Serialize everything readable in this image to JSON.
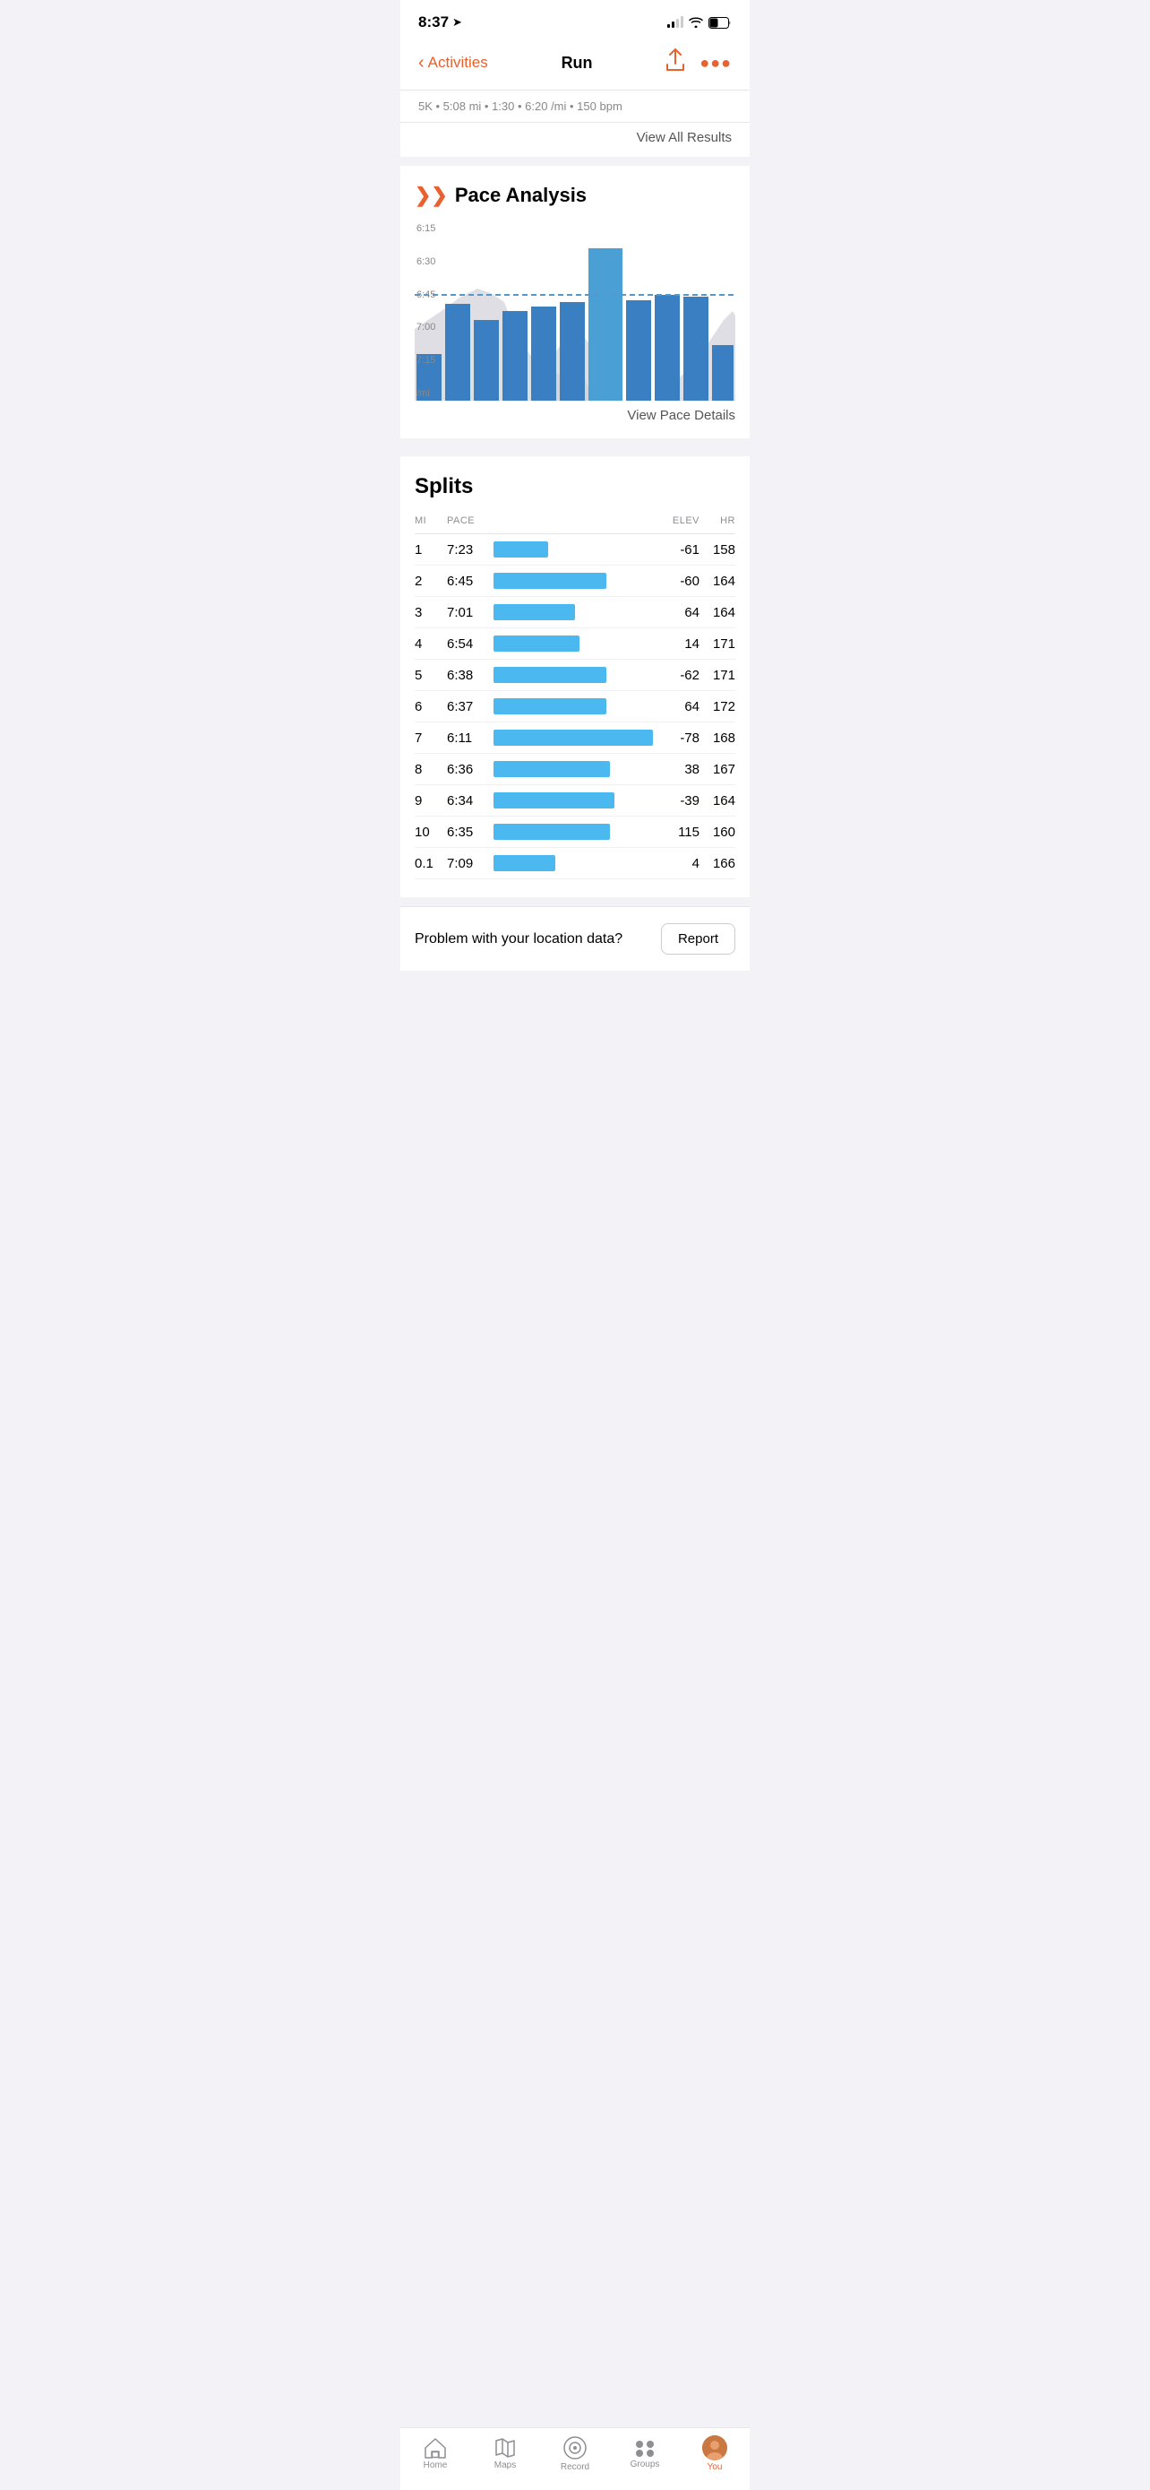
{
  "statusBar": {
    "time": "8:37",
    "locationIcon": "➤"
  },
  "navBar": {
    "backLabel": "Activities",
    "title": "Run",
    "shareLabel": "share",
    "moreLabel": "•••"
  },
  "topCutoff": {
    "text": "5K  •  5:08 mi  •  1:30  •  6:20 /mi  •  150 bpm"
  },
  "viewAllResults": "View All Results",
  "paceAnalysis": {
    "title": "Pace Analysis",
    "yLabels": [
      "6:15",
      "6:30",
      "6:45",
      "7:00",
      "7:15",
      "/mi"
    ],
    "viewPaceDetails": "View Pace Details"
  },
  "splits": {
    "title": "Splits",
    "headers": {
      "mi": "MI",
      "pace": "PACE",
      "elev": "ELEV",
      "hr": "HR"
    },
    "rows": [
      {
        "mi": "1",
        "pace": "7:23",
        "barWidth": 28,
        "elev": "-61",
        "hr": "158"
      },
      {
        "mi": "2",
        "pace": "6:45",
        "barWidth": 58,
        "elev": "-60",
        "hr": "164"
      },
      {
        "mi": "3",
        "pace": "7:01",
        "barWidth": 42,
        "elev": "64",
        "hr": "164"
      },
      {
        "mi": "4",
        "pace": "6:54",
        "barWidth": 44,
        "elev": "14",
        "hr": "171"
      },
      {
        "mi": "5",
        "pace": "6:38",
        "barWidth": 58,
        "elev": "-62",
        "hr": "171"
      },
      {
        "mi": "6",
        "pace": "6:37",
        "barWidth": 58,
        "elev": "64",
        "hr": "172"
      },
      {
        "mi": "7",
        "pace": "6:11",
        "barWidth": 82,
        "elev": "-78",
        "hr": "168"
      },
      {
        "mi": "8",
        "pace": "6:36",
        "barWidth": 60,
        "elev": "38",
        "hr": "167"
      },
      {
        "mi": "9",
        "pace": "6:34",
        "barWidth": 62,
        "elev": "-39",
        "hr": "164"
      },
      {
        "mi": "10",
        "pace": "6:35",
        "barWidth": 60,
        "elev": "115",
        "hr": "160"
      },
      {
        "mi": "0.1",
        "pace": "7:09",
        "barWidth": 32,
        "elev": "4",
        "hr": "166"
      }
    ]
  },
  "problemBanner": {
    "text": "Problem with your location data?",
    "buttonLabel": "Report"
  },
  "tabBar": {
    "tabs": [
      {
        "id": "home",
        "label": "Home",
        "icon": "home",
        "active": false
      },
      {
        "id": "maps",
        "label": "Maps",
        "icon": "maps",
        "active": false
      },
      {
        "id": "record",
        "label": "Record",
        "icon": "record",
        "active": false
      },
      {
        "id": "groups",
        "label": "Groups",
        "icon": "groups",
        "active": false
      },
      {
        "id": "you",
        "label": "You",
        "icon": "avatar",
        "active": true
      }
    ]
  }
}
